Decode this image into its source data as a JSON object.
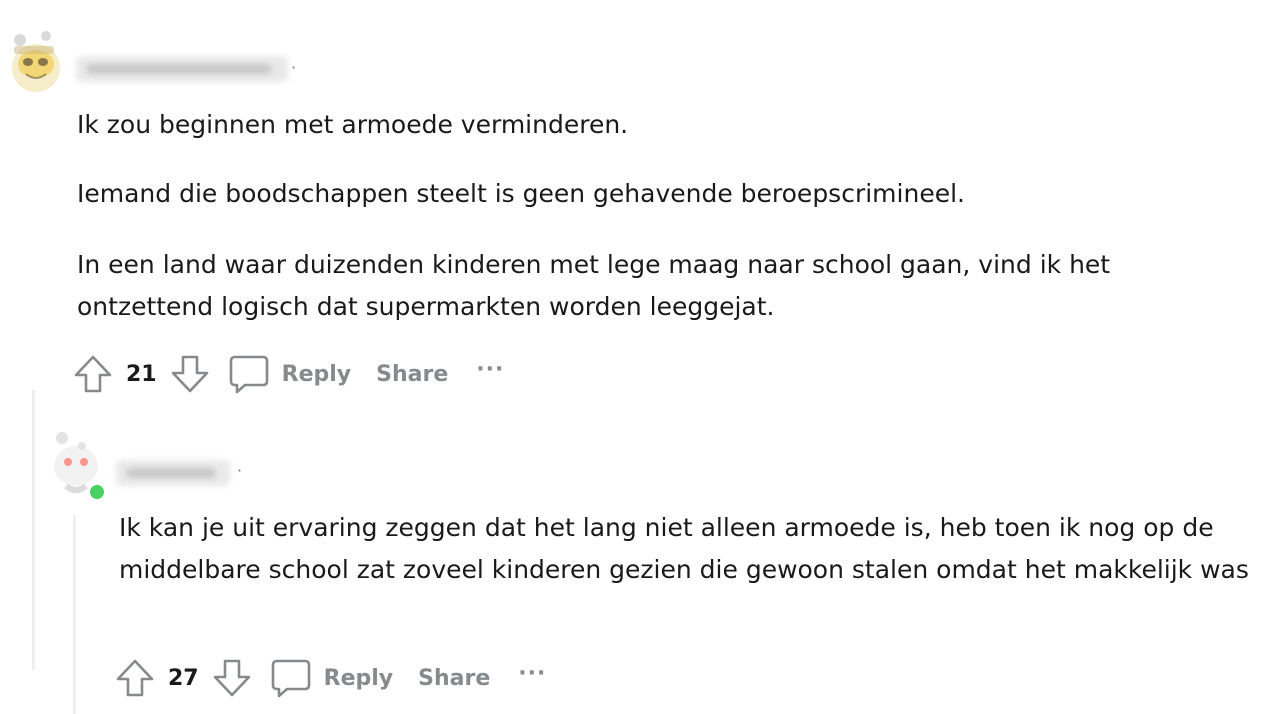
{
  "comments": [
    {
      "author": "Weekly_Wanderer",
      "paragraphs": [
        "Ik zou beginnen met armoede verminderen.",
        "Iemand die boodschappen steelt is geen gehavende beroepscrimineel.",
        "In een land waar duizenden kinderen met lege maag naar school gaan, vind ik het ontzettend logisch dat supermarkten worden leeggejat."
      ],
      "score": "21",
      "reply_label": "Reply",
      "share_label": "Share",
      "more_label": "···"
    },
    {
      "author": "Seeeeedsl",
      "paragraphs": [
        "Ik kan je uit ervaring zeggen dat het lang niet alleen armoede is, heb toen ik nog op de middelbare school zat zoveel kinderen gezien die gewoon stalen omdat het makkelijk was"
      ],
      "score": "27",
      "reply_label": "Reply",
      "share_label": "Share",
      "more_label": "···"
    }
  ],
  "colors": {
    "text": "#1a1a1b",
    "muted": "#878a8c",
    "thread_line": "#edeff1",
    "online": "#46d160"
  },
  "icons": [
    "upvote-icon",
    "downvote-icon",
    "comment-bubble-icon",
    "more-icon"
  ]
}
